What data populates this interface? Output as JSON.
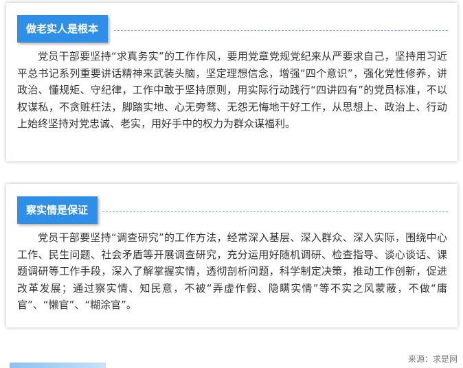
{
  "sections": [
    {
      "title": "做老实人是根本",
      "text": "党员干部要坚持“求真务实”的工作作风，要用党章党规党纪来从严要求自己，坚持用习近平总书记系列重要讲话精神来武装头脑，坚定理想信念，增强“四个意识”，强化党性修养，讲政治、懂规矩、守纪律，工作中敢于坚持原则，用实际行动践行“四讲四有”的党员标准，不以权谋私，不贪赃枉法，脚踏实地、心无旁骛、无怨无悔地干好工作，从思想上、政治上、行动上始终坚持对党忠诚、老实，用好手中的权力为群众谋福利。"
    },
    {
      "title": "察实情是保证",
      "text": "党员干部要坚持“调查研究”的工作方法，经常深入基层、深入群众、深入实际，围绕中心工作、民生问题、社会矛盾等开展调查研究，充分运用好随机调研、检查指导、谈心谈话、课题调研等工作手段，深入了解掌握实情，透彻剖析问题，科学制定决策，推动工作创新，促进改革发展；通过察实情、知民意，不被“弄虚作假、隐瞒实情”等不实之风蒙蔽，不做“庸官”、“懒官”、“糊涂官”。"
    }
  ],
  "source": "来源：求是网",
  "colors": {
    "accent": "#2f8ee6",
    "text": "#333333",
    "dash": "#7aa6cf"
  }
}
